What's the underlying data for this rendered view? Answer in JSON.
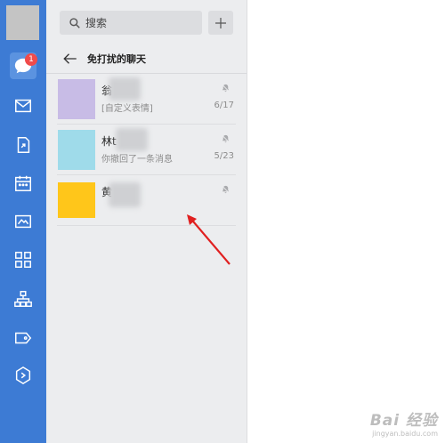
{
  "sidebar": {
    "unread_badge": "1",
    "items": [
      {
        "icon": "chat-bubble-icon",
        "active": true
      },
      {
        "icon": "mail-icon"
      },
      {
        "icon": "document-share-icon"
      },
      {
        "icon": "calendar-icon"
      },
      {
        "icon": "drive-icon"
      },
      {
        "icon": "apps-grid-icon"
      },
      {
        "icon": "org-chart-icon"
      },
      {
        "icon": "tag-icon"
      },
      {
        "icon": "cube-icon"
      }
    ]
  },
  "search": {
    "placeholder": "搜索"
  },
  "header": {
    "title": "免打扰的聊天"
  },
  "conversations": [
    {
      "name": "翁",
      "preview": "[自定义表情]",
      "date": "6/17",
      "avatar_color": "#c8bce6",
      "muted": true
    },
    {
      "name": "林t",
      "preview": "你撤回了一条消息",
      "date": "5/23",
      "avatar_color": "#9fdbea",
      "muted": true
    },
    {
      "name": "黄",
      "preview": "",
      "date": "",
      "avatar_color": "#ffc61a",
      "muted": true
    }
  ],
  "watermark": {
    "main": "Bai 经验",
    "sub": "jingyan.baidu.com"
  },
  "colors": {
    "sidebar": "#3d7bd4",
    "panel": "#ecedef",
    "badge": "#f04b4b",
    "annotation_arrow": "#e02020"
  }
}
